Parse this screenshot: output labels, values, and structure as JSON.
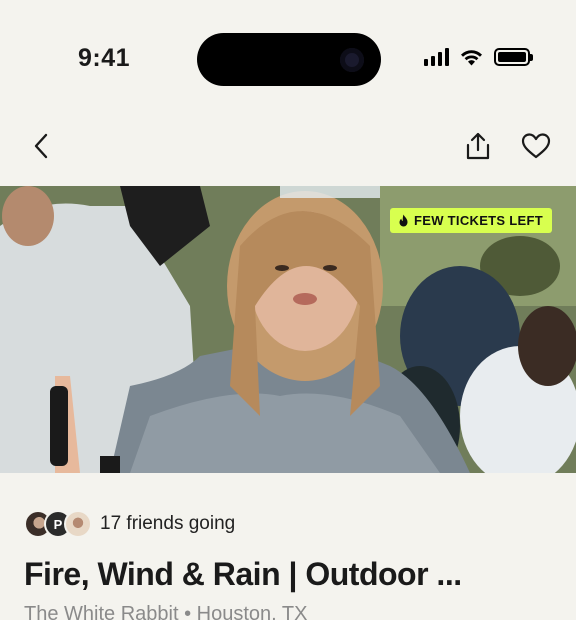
{
  "status_bar": {
    "time": "9:41",
    "signal_icon": "cellular-signal-icon",
    "wifi_icon": "wifi-icon",
    "battery_icon": "battery-icon",
    "battery_level": 1.0
  },
  "nav": {
    "back_icon": "chevron-left-icon",
    "share_icon": "share-icon",
    "favorite_icon": "heart-icon"
  },
  "hero": {
    "badge_icon": "flame-icon",
    "badge_label": "FEW TICKETS LEFT",
    "badge_color": "#d8ff4f"
  },
  "event": {
    "friends_going": "17 friends going",
    "avatar_initial": "P",
    "title": "Fire, Wind & Rain | Outdoor ...",
    "venue_line": "The White Rabbit • Houston, TX"
  },
  "colors": {
    "background": "#f4f3ee",
    "text": "#1a1a1a",
    "muted": "#8a8a8a"
  }
}
